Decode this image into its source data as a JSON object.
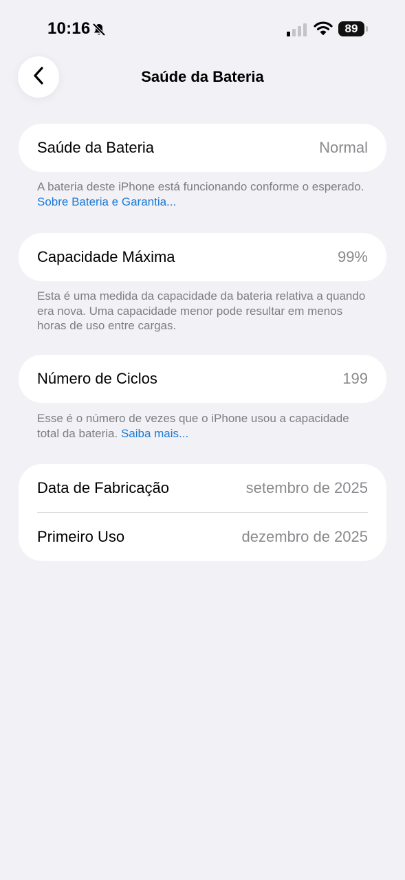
{
  "status_bar": {
    "time": "10:16",
    "battery_level": "89",
    "icons": [
      "bell-slash-icon",
      "cellular-signal-icon",
      "wifi-icon",
      "battery-icon"
    ]
  },
  "nav": {
    "title": "Saúde da Bateria",
    "back_icon": "chevron-left-icon"
  },
  "sections": {
    "health": {
      "label": "Saúde da Bateria",
      "value": "Normal",
      "footnote_text": "A bateria deste iPhone está funcionando conforme o esperado.",
      "footnote_link": "Sobre Bateria e Garantia..."
    },
    "capacity": {
      "label": "Capacidade Máxima",
      "value": "99%",
      "footnote_text": "Esta é uma medida da capacidade da bateria relativa a quando era nova. Uma capacidade menor pode resultar em menos horas de uso entre cargas."
    },
    "cycles": {
      "label": "Número de Ciclos",
      "value": "199",
      "footnote_text": "Esse é o número de vezes que o iPhone usou a capacidade total da bateria.",
      "footnote_link": "Saiba mais..."
    },
    "dates": {
      "manufacture_label": "Data de Fabricação",
      "manufacture_value": "setembro de 2025",
      "first_use_label": "Primeiro Uso",
      "first_use_value": "dezembro de 2025"
    }
  },
  "colors": {
    "background": "#f2f1f6",
    "card": "#ffffff",
    "secondary_text": "#8a8a8e",
    "link": "#1a7ad6"
  }
}
